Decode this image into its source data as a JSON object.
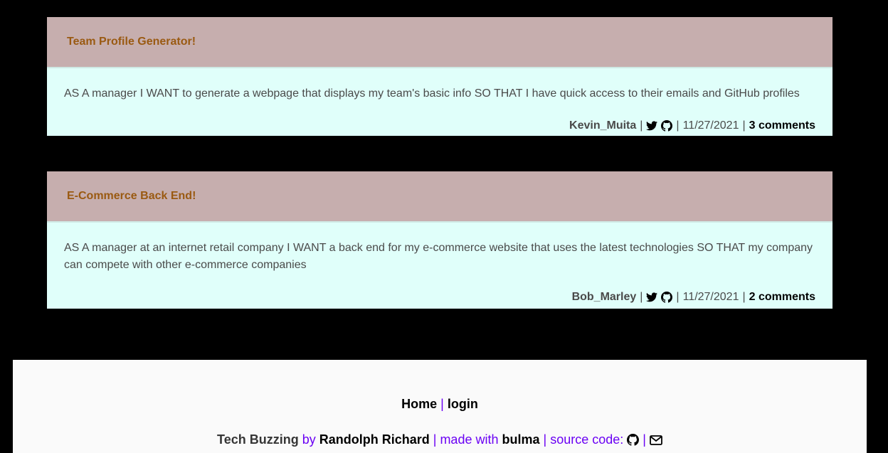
{
  "posts": [
    {
      "title": "Team Profile Generator!",
      "description": "AS A manager I WANT to generate a webpage that displays my team's basic info SO THAT I have quick access to their emails and GitHub profiles",
      "author": "Kevin_Muita",
      "date": "11/27/2021",
      "comments": "3 comments"
    },
    {
      "title": "E-Commerce Back End!",
      "description": "AS A manager at an internet retail company I WANT a back end for my e-commerce website that uses the latest technologies SO THAT my company can compete with other e-commerce companies",
      "author": "Bob_Marley",
      "date": "11/27/2021",
      "comments": "2 comments"
    }
  ],
  "separator": "|",
  "footer": {
    "nav": {
      "home": "Home",
      "login": "login"
    },
    "credit": {
      "site_name": "Tech Buzzing",
      "by": "by",
      "author": "Randolph Richard",
      "made_with": "made with",
      "framework": "bulma",
      "source_code": "source code:"
    }
  },
  "icons": [
    "twitter-icon",
    "github-icon",
    "envelope-icon"
  ],
  "colors": {
    "background": "#000000",
    "card_header": "#c6aeae",
    "card_title": "#9a5a12",
    "card_body": "#e0fffa",
    "footer_bg": "#fafafa",
    "accent_purple": "#6a00f4"
  }
}
